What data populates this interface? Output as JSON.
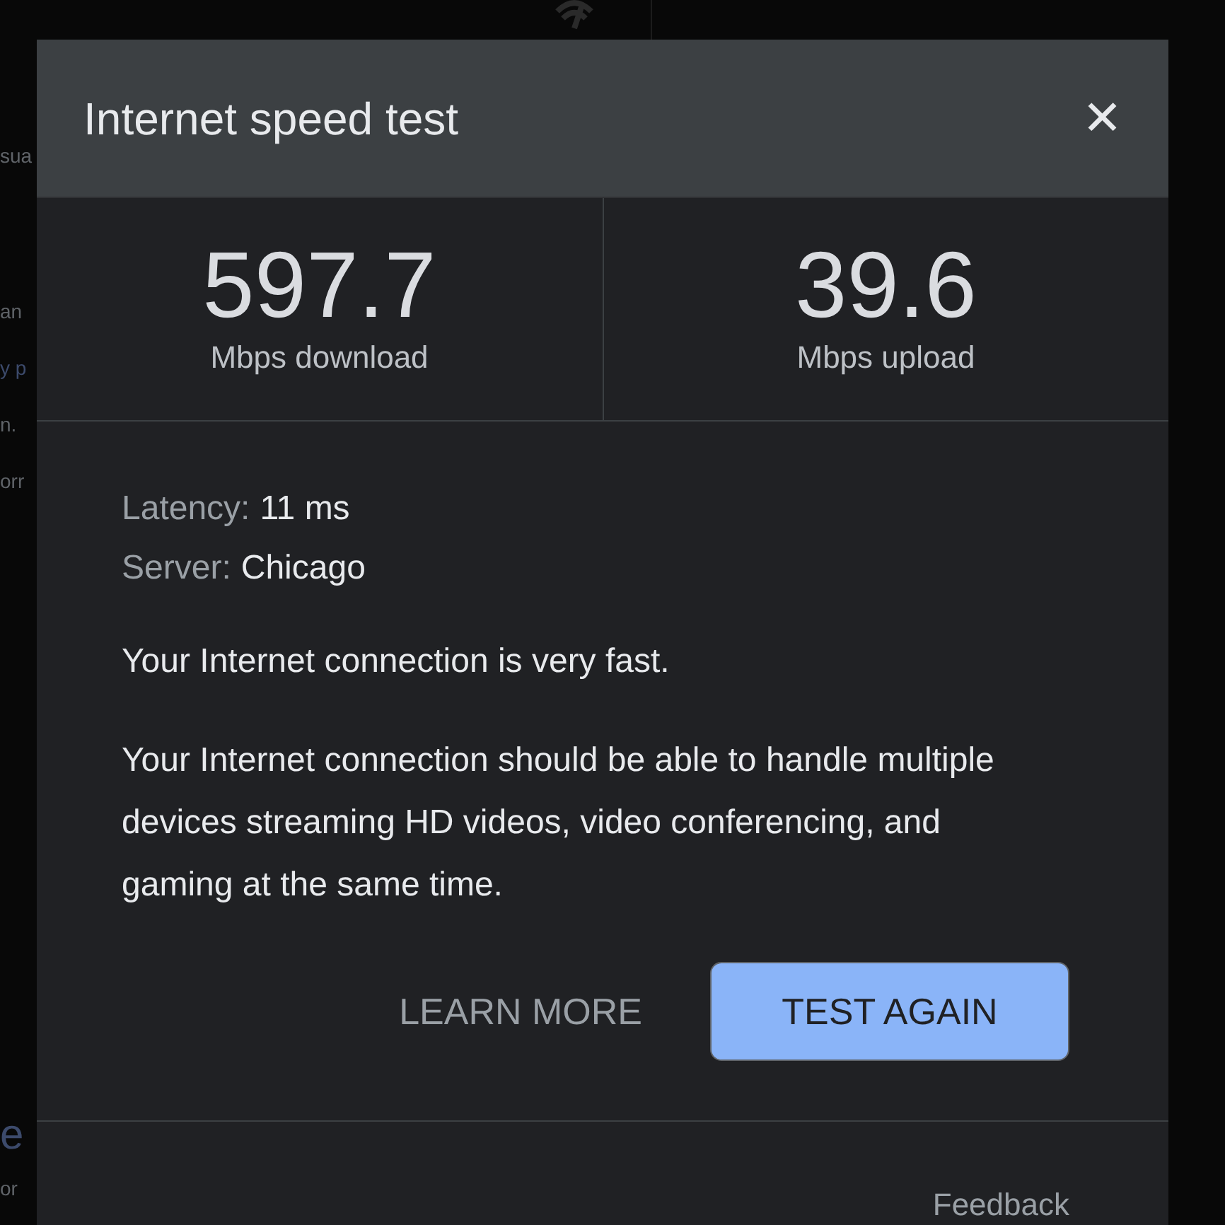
{
  "background": {
    "fragments": [
      "sua",
      "an",
      "y p",
      "n.",
      "orr",
      "e",
      "or"
    ]
  },
  "dialog": {
    "title": "Internet speed test",
    "close": "✕",
    "results": [
      {
        "value": "597.7",
        "label": "Mbps download"
      },
      {
        "value": "39.6",
        "label": "Mbps upload"
      }
    ],
    "details": [
      {
        "label": "Latency:",
        "value": "11 ms"
      },
      {
        "label": "Server:",
        "value": "Chicago"
      }
    ],
    "summary": "Your Internet connection is very fast.",
    "description": "Your Internet connection should be able to handle multiple devices streaming HD videos, video conferencing, and gaming at the same time.",
    "buttons": [
      {
        "label": "LEARN MORE",
        "kind": "text"
      },
      {
        "label": "TEST AGAIN",
        "kind": "filled"
      }
    ],
    "feedback": "Feedback"
  }
}
